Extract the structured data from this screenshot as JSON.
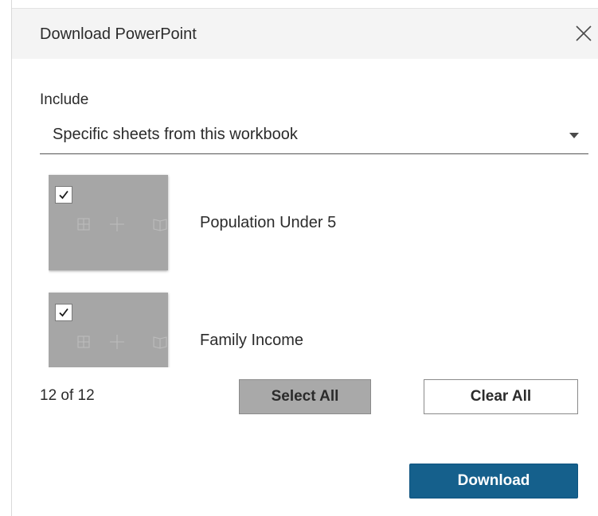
{
  "dialog": {
    "title": "Download PowerPoint",
    "close_icon": "close-icon"
  },
  "include": {
    "label": "Include",
    "selected_value": "Specific sheets from this workbook",
    "dropdown_icon": "caret-down-icon"
  },
  "sheets": [
    {
      "label": "Population Under 5",
      "checked": true,
      "icons": [
        "grid-icon",
        "plus-icon",
        "book-icon"
      ]
    },
    {
      "label": "Family Income",
      "checked": true,
      "icons": [
        "grid-icon",
        "plus-icon",
        "book-icon"
      ]
    }
  ],
  "selection": {
    "count_text": "12 of 12"
  },
  "buttons": {
    "select_all": "Select All",
    "clear_all": "Clear All",
    "download": "Download"
  },
  "colors": {
    "primary": "#15608c",
    "thumbnail": "#a6a6a6",
    "select_all_bg": "#a9a9a9",
    "header_bg": "#f4f4f4"
  }
}
